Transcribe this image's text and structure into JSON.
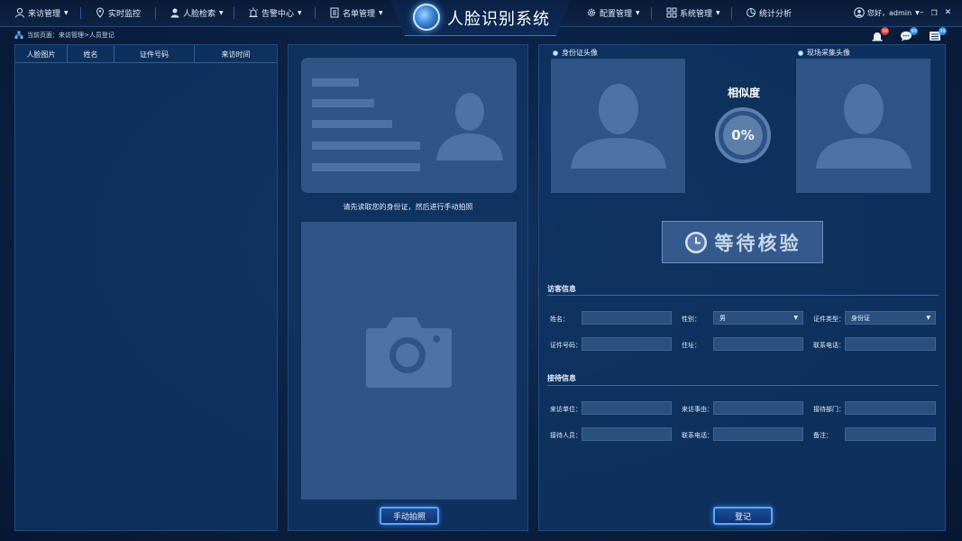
{
  "app": {
    "title": "人脸识别系统"
  },
  "nav": {
    "left": [
      {
        "label": "来访管理",
        "icon": "user-icon",
        "dropdown": true
      },
      {
        "label": "实时监控",
        "icon": "location-icon",
        "dropdown": false
      },
      {
        "label": "人脸检索",
        "icon": "face-search-icon",
        "dropdown": true
      },
      {
        "label": "告警中心",
        "icon": "alarm-icon",
        "dropdown": true
      },
      {
        "label": "名单管理",
        "icon": "list-icon",
        "dropdown": true
      }
    ],
    "right": [
      {
        "label": "配置管理",
        "icon": "gear-icon",
        "dropdown": true
      },
      {
        "label": "系统管理",
        "icon": "grid-icon",
        "dropdown": true
      },
      {
        "label": "统计分析",
        "icon": "pie-chart-icon",
        "dropdown": false
      }
    ],
    "user": {
      "greeting": "您好，admin"
    }
  },
  "breadcrumb": {
    "prefix": "当前页面：",
    "path": "来访管理>人员登记"
  },
  "toolbar": {
    "badges": [
      {
        "icon": "alarm-bell-icon",
        "count": "99",
        "color": "#e23a3a"
      },
      {
        "icon": "message-icon",
        "count": "99",
        "color": "#2f8de6"
      },
      {
        "icon": "list-icon",
        "count": "99",
        "color": "#2f8de6"
      }
    ]
  },
  "records": {
    "columns": [
      "人脸图片",
      "姓名",
      "证件号码",
      "来访时间"
    ],
    "rows": []
  },
  "capture": {
    "hint": "请先读取您的身份证，然后进行手动拍照",
    "button": "手动拍照"
  },
  "compare": {
    "id_photo_label": "身份证头像",
    "live_photo_label": "现场采集头像",
    "similarity_title": "相似度",
    "similarity_value": "0%",
    "similarity_percent": 0,
    "status": "等待核验"
  },
  "visitor": {
    "title": "访客信息",
    "fields": {
      "name": {
        "label": "姓名：",
        "value": ""
      },
      "gender": {
        "label": "性别：",
        "value": "男"
      },
      "id_type": {
        "label": "证件类型：",
        "value": "身份证"
      },
      "id_number": {
        "label": "证件号码：",
        "value": ""
      },
      "address": {
        "label": "住址：",
        "value": ""
      },
      "phone": {
        "label": "联系电话：",
        "value": ""
      }
    }
  },
  "reception": {
    "title": "接待信息",
    "fields": {
      "unit": {
        "label": "来访单位：",
        "value": ""
      },
      "reason": {
        "label": "来访事由：",
        "value": ""
      },
      "department": {
        "label": "接待部门：",
        "value": ""
      },
      "host": {
        "label": "接待人员：",
        "value": ""
      },
      "phone": {
        "label": "联系电话：",
        "value": ""
      },
      "remark": {
        "label": "备注：",
        "value": ""
      }
    }
  },
  "register": {
    "button": "登记"
  }
}
